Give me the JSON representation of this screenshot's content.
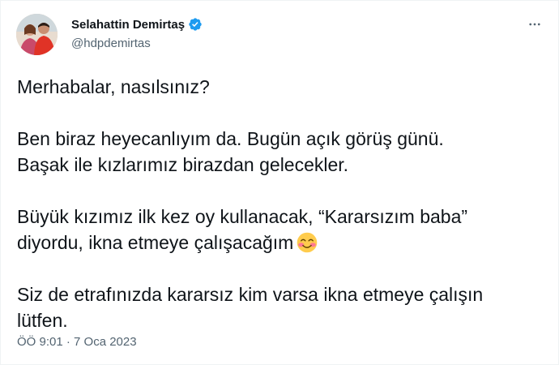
{
  "author": {
    "name": "Selahattin Demirtaş",
    "handle": "@hdpdemirtas"
  },
  "icons": {
    "verified": "verified-badge-icon",
    "more": "more-options-icon",
    "emoji": "smiling-face-with-smiling-eyes"
  },
  "tweet": {
    "line1": "Merhabalar, nasılsınız?",
    "line2": "Ben biraz heyecanlıyım da. Bugün açık görüş günü.",
    "line3": "Başak ile kızlarımız birazdan gelecekler.",
    "line4": "Büyük kızımız ilk kez oy kullanacak, “Kararsızım baba”",
    "line5": "diyordu, ikna etmeye çalışacağım",
    "line6": "Siz de etrafınızda kararsız kim varsa ikna etmeye çalışın",
    "line7": "lütfen."
  },
  "meta": {
    "timestamp": "ÖÖ 9:01 · 7 Oca 2023"
  },
  "colors": {
    "verified": "#1d9bf0",
    "secondary_text": "#536471",
    "primary_text": "#0f1419"
  }
}
